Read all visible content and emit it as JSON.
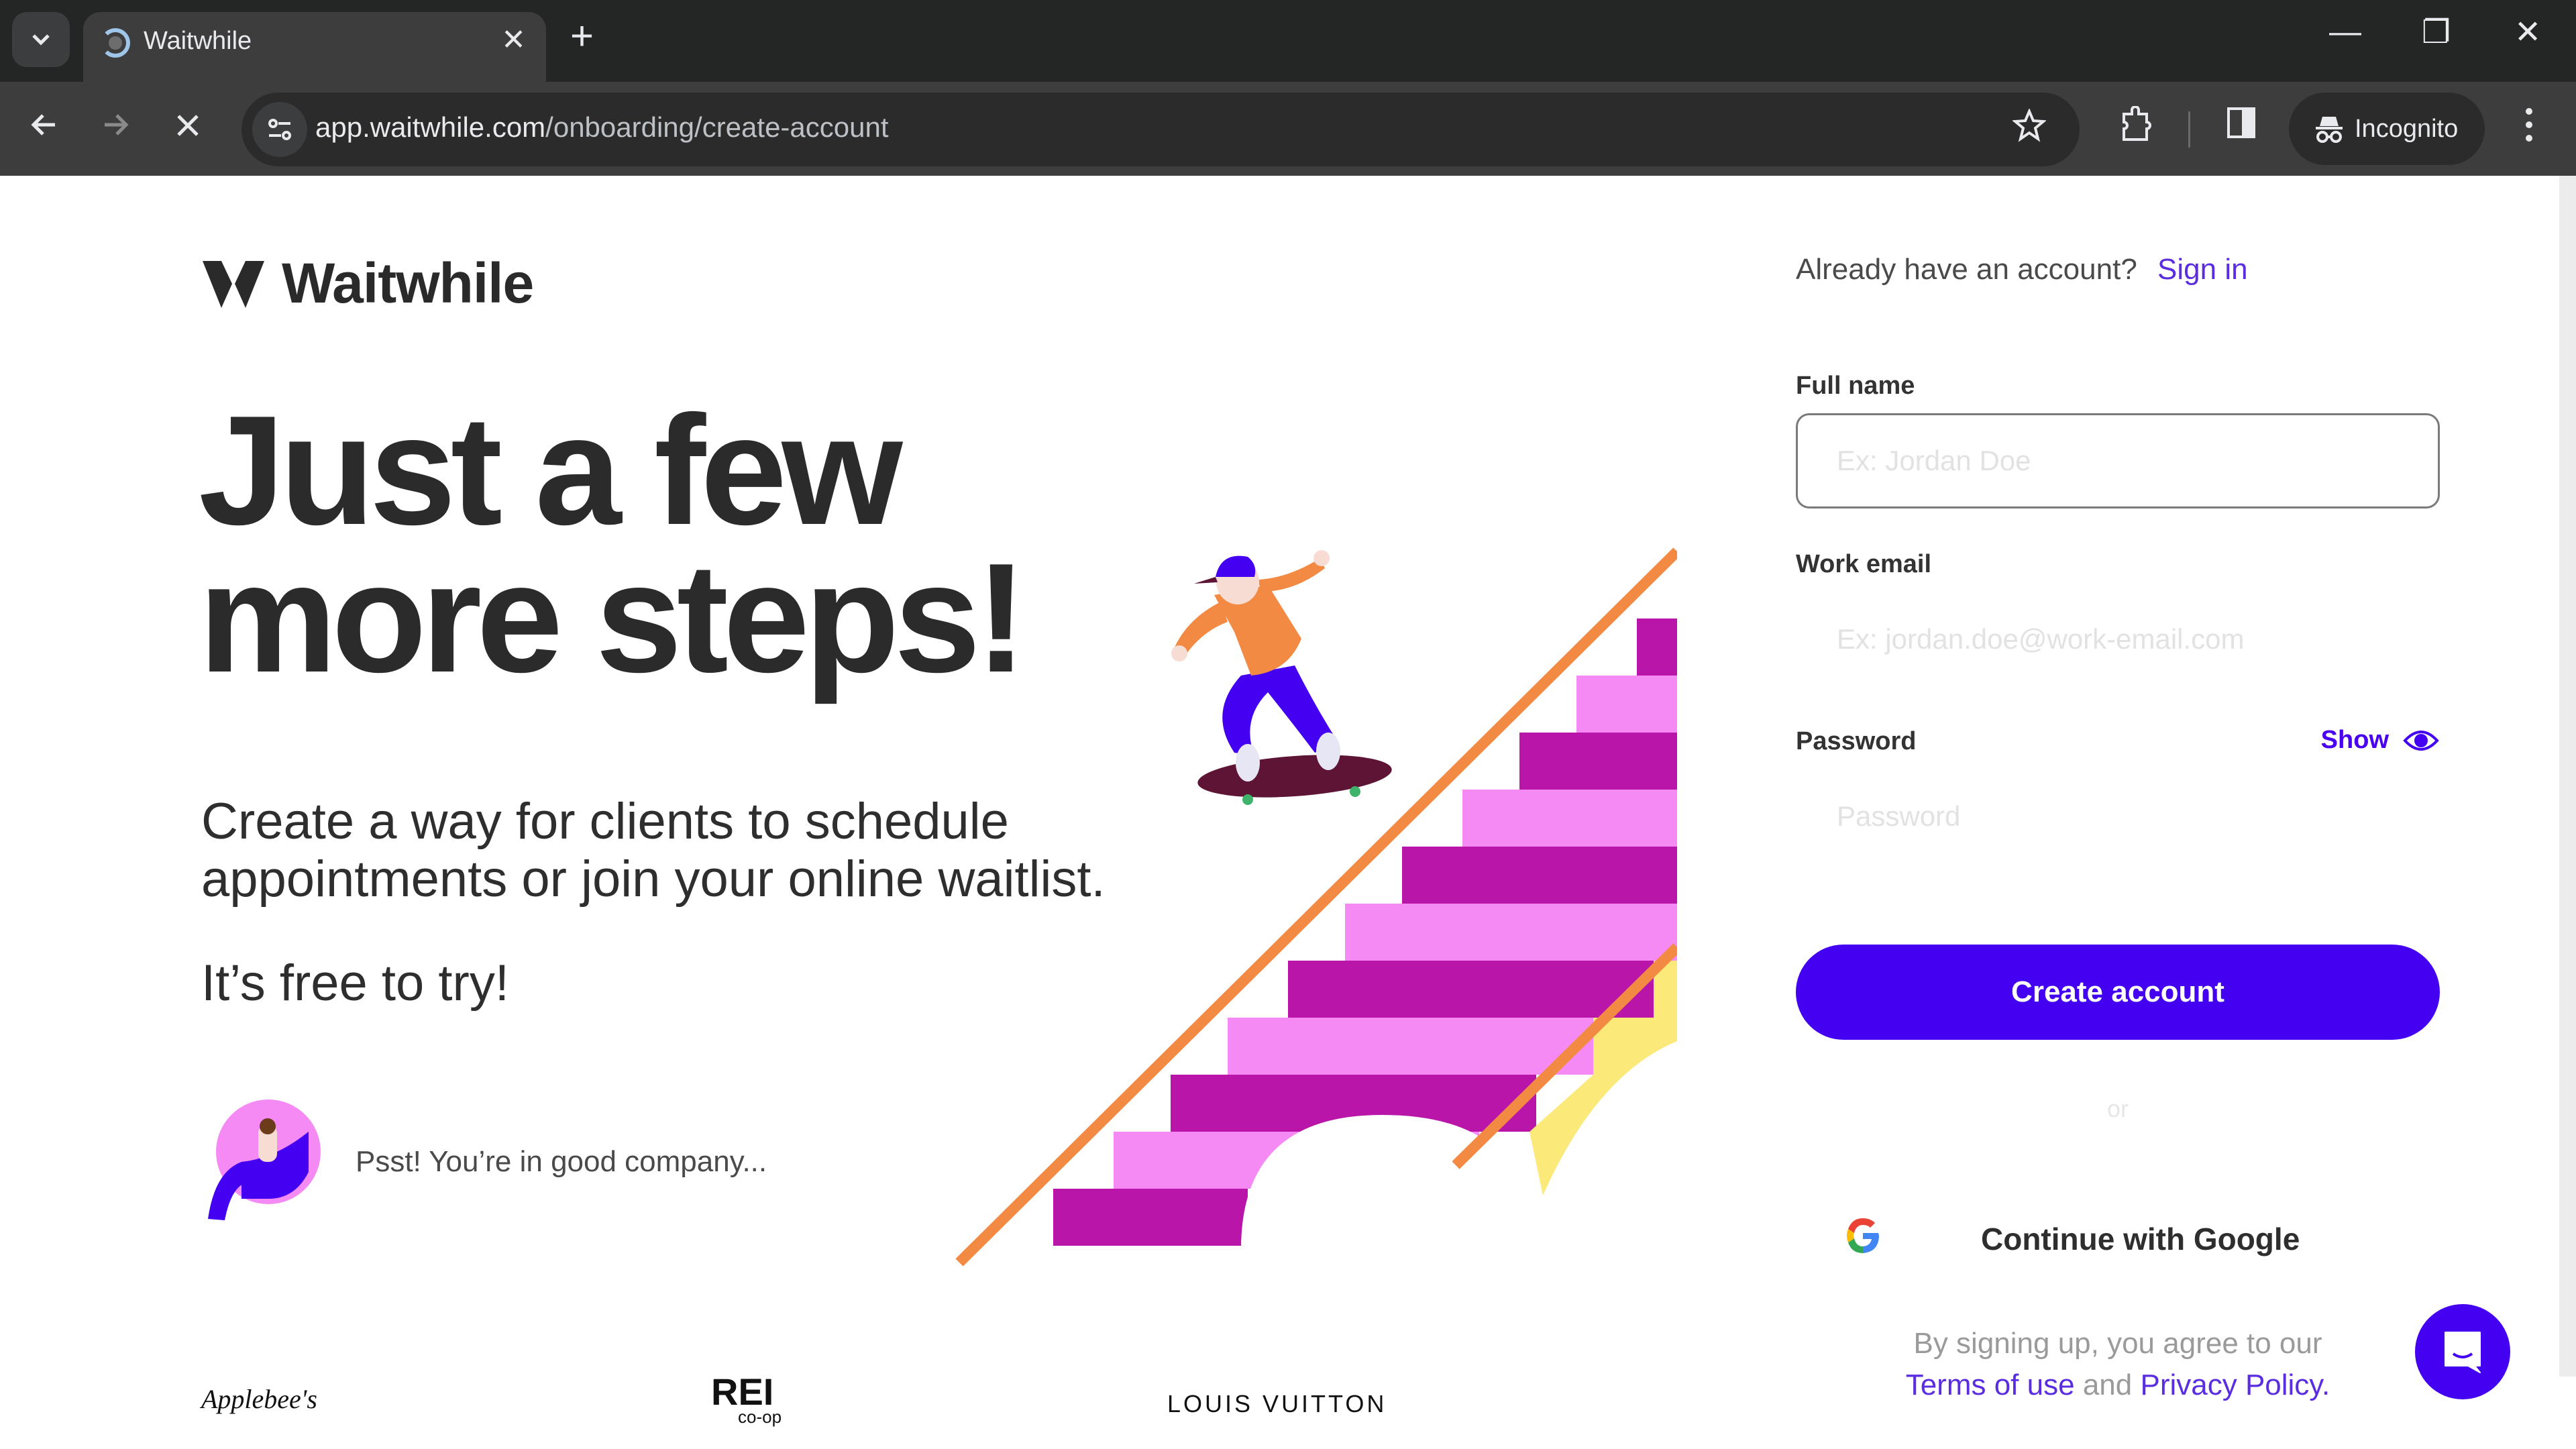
{
  "browser": {
    "tab_title": "Waitwhile",
    "url_host": "app.waitwhile.com",
    "url_path": "/onboarding/create-account",
    "incognito_label": "Incognito",
    "icons": {
      "tab_list": "chevron-down-icon",
      "new_tab": "plus-icon",
      "back": "arrow-left-icon",
      "forward": "arrow-right-icon",
      "stop": "close-icon",
      "site_info": "tune-icon",
      "bookmark": "star-icon",
      "extensions": "puzzle-icon",
      "side_panel": "side-panel-icon",
      "incognito": "incognito-icon",
      "menu": "more-vertical-icon",
      "minimize": "minimize-icon",
      "restore": "restore-icon",
      "close_window": "close-icon"
    }
  },
  "page": {
    "brand": {
      "name": "Waitwhile"
    },
    "headline_line1": "Just a few",
    "headline_line2": "more steps!",
    "lead": "Create a way for clients to schedule appointments or join your online waitlist.",
    "free": "It’s free to try!",
    "company_text": "Psst! You’re in good company...",
    "customer_logos": [
      "Applebee's",
      "REI",
      "co-op",
      "LOUIS VUITTON"
    ]
  },
  "form": {
    "signin_prompt": "Already have an account?",
    "signin_link": "Sign in",
    "full_name_label": "Full name",
    "full_name_placeholder": "Ex: Jordan Doe",
    "full_name_value": "",
    "email_label": "Work email",
    "email_placeholder": "Ex: jordan.doe@work-email.com",
    "email_value": "",
    "password_label": "Password",
    "password_placeholder": "Password",
    "password_value": "",
    "show_label": "Show",
    "create_button": "Create account",
    "or_divider": "or",
    "google_button": "Continue with Google",
    "legal_prefix": "By signing up, you agree to our",
    "terms_link": "Terms of use",
    "legal_and": "and",
    "privacy_link": "Privacy Policy."
  },
  "colors": {
    "accent": "#4400f0",
    "link": "#5a2de0",
    "magenta": "#b915a8",
    "pink": "#f58af5",
    "orange": "#f28a44",
    "yellow": "#fbe97a"
  }
}
